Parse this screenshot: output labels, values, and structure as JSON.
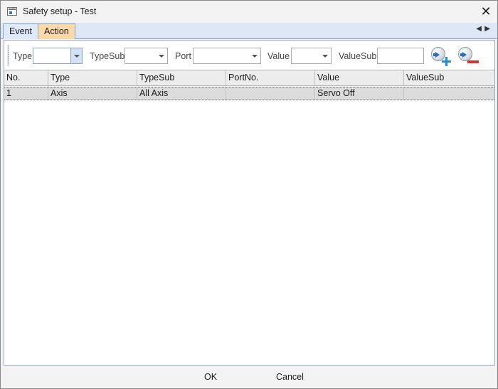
{
  "window": {
    "title": "Safety setup - Test"
  },
  "tabs": [
    {
      "label": "Event",
      "active": false
    },
    {
      "label": "Action",
      "active": true
    }
  ],
  "toolbar": {
    "type_label": "Type",
    "typesub_label": "TypeSub",
    "port_label": "Port",
    "value_label": "Value",
    "valuesub_label": "ValueSub",
    "type_value": "",
    "typesub_value": "",
    "port_value": "",
    "value_value": "",
    "valuesub_value": ""
  },
  "grid": {
    "columns": [
      "No.",
      "Type",
      "TypeSub",
      "PortNo.",
      "Value",
      "ValueSub"
    ],
    "rows": [
      {
        "no": "1",
        "type": "Axis",
        "typesub": "All Axis",
        "portno": "",
        "value": "Servo Off",
        "valuesub": ""
      }
    ]
  },
  "footer": {
    "ok_label": "OK",
    "cancel_label": "Cancel"
  },
  "colors": {
    "active_tab": "#fcd9a8",
    "tab_strip": "#dde7f5",
    "selected_row": "#dcdcdc",
    "add_icon": "#1f8fd8",
    "remove_icon": "#d8332a"
  },
  "icons": {
    "add": "add-action-icon",
    "remove": "remove-action-icon",
    "close": "close-icon",
    "app": "window-app-icon"
  }
}
